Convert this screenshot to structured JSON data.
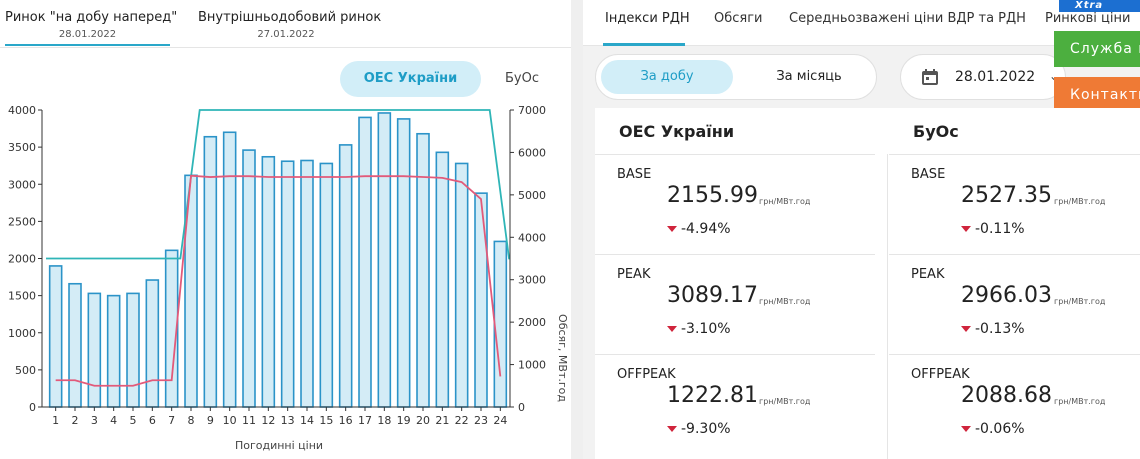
{
  "left": {
    "tabs": [
      {
        "title": "Ринок \"на добу наперед\"",
        "date": "28.01.2022"
      },
      {
        "title": "Внутрішньодобовий ринок",
        "date": "27.01.2022"
      }
    ],
    "zone_active": "ОЕС України",
    "zone_other": "БуОс"
  },
  "chart_data": {
    "type": "bar",
    "title": "",
    "xlabel": "Погодинні ціни",
    "ylabel": "",
    "y2label": "Обсяг, МВт.год",
    "categories": [
      "1",
      "2",
      "3",
      "4",
      "5",
      "6",
      "7",
      "8",
      "9",
      "10",
      "11",
      "12",
      "13",
      "14",
      "15",
      "16",
      "17",
      "18",
      "19",
      "20",
      "21",
      "22",
      "23",
      "24"
    ],
    "ylim": [
      0,
      4000
    ],
    "yticks": [
      0,
      500,
      1000,
      1500,
      2000,
      2500,
      3000,
      3500,
      4000
    ],
    "y2lim": [
      0,
      7000
    ],
    "y2ticks": [
      0,
      1000,
      2000,
      3000,
      4000,
      5000,
      6000,
      7000
    ],
    "series": [
      {
        "axis": "left",
        "kind": "bar",
        "values": [
          1900,
          1660,
          1530,
          1500,
          1530,
          1710,
          2110,
          3120,
          3640,
          3700,
          3460,
          3370,
          3310,
          3320,
          3280,
          3530,
          3900,
          3960,
          3880,
          3680,
          3430,
          3280,
          2880,
          2230
        ]
      },
      {
        "axis": "right",
        "kind": "step",
        "values": [
          3500,
          3500,
          3500,
          3500,
          3500,
          3500,
          3500,
          7000,
          7000,
          7000,
          7000,
          7000,
          7000,
          7000,
          7000,
          7000,
          7000,
          7000,
          7000,
          7000,
          7000,
          7000,
          7000,
          3500
        ]
      },
      {
        "axis": "right",
        "kind": "line",
        "values": [
          630,
          630,
          500,
          500,
          500,
          630,
          630,
          5450,
          5420,
          5440,
          5440,
          5420,
          5420,
          5420,
          5420,
          5420,
          5440,
          5440,
          5440,
          5420,
          5400,
          5300,
          4900,
          720
        ]
      }
    ],
    "colors": {
      "bar_fill": "#d4ecf6",
      "bar_stroke": "#2b93c8",
      "step": "#2fb5b7",
      "line": "#e25a7a"
    },
    "grid": false
  },
  "right": {
    "tabs": [
      "Індекси РДН",
      "Обсяги",
      "Середньозважені ціни ВДР та РДН",
      "Ринкові ціни"
    ],
    "period": {
      "day": "За добу",
      "month": "За місяць"
    },
    "date": "28.01.2022",
    "side_buttons": [
      {
        "label": "Xtra",
        "color": "#1c6fd1"
      },
      {
        "label": "Служба підтримки",
        "color": "#4caf3f"
      },
      {
        "label": "Контакти",
        "color": "#ef7a35"
      }
    ],
    "columns": [
      "ОЕС України",
      "БуОс"
    ],
    "unit": "грн/МВт.год",
    "cards": [
      {
        "label": "BASE",
        "ues": {
          "price": "2155.99",
          "change": "-4.94%"
        },
        "buos": {
          "price": "2527.35",
          "change": "-0.11%"
        }
      },
      {
        "label": "PEAK",
        "ues": {
          "price": "3089.17",
          "change": "-3.10%"
        },
        "buos": {
          "price": "2966.03",
          "change": "-0.13%"
        }
      },
      {
        "label": "OFFPEAK",
        "ues": {
          "price": "1222.81",
          "change": "-9.30%"
        },
        "buos": {
          "price": "2088.68",
          "change": "-0.06%"
        }
      }
    ]
  }
}
